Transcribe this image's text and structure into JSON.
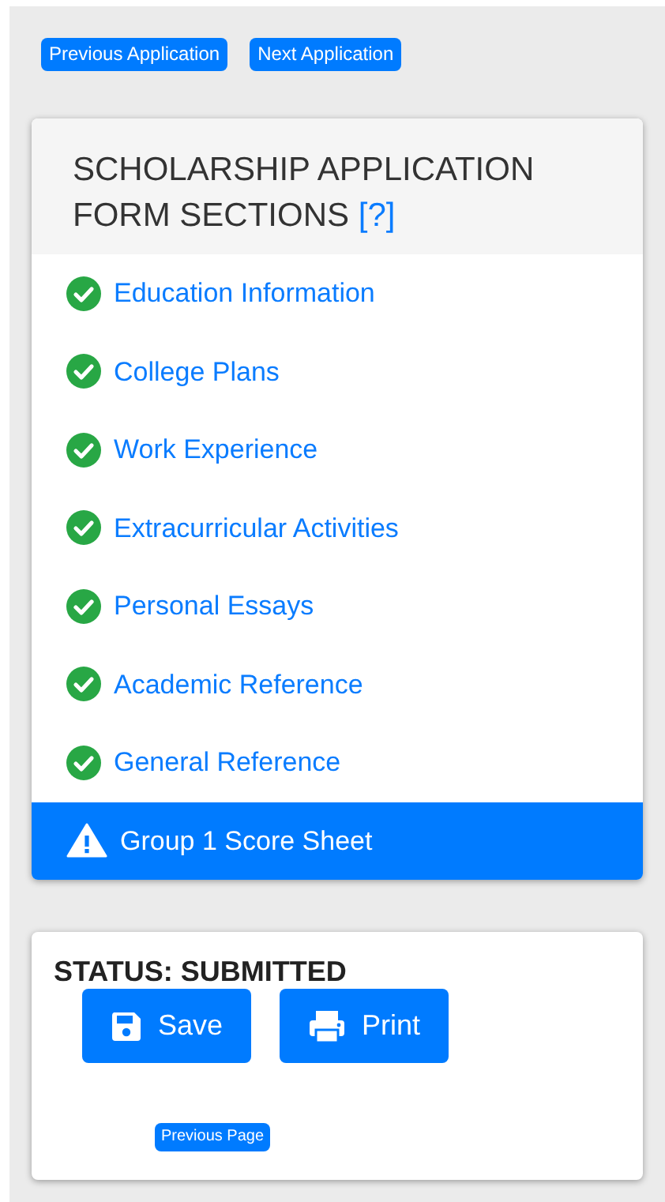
{
  "top_buttons": [
    "Previous Application",
    "Next Application"
  ],
  "sections_card": {
    "title": "SCHOLARSHIP APPLICATION FORM SECTIONS",
    "help_link": "[?]",
    "items": [
      {
        "label": "Education Information",
        "kind": "complete",
        "selected": false
      },
      {
        "label": "College Plans",
        "kind": "complete",
        "selected": false
      },
      {
        "label": "Work Experience",
        "kind": "complete",
        "selected": false
      },
      {
        "label": "Extracurricular Activities",
        "kind": "complete",
        "selected": false
      },
      {
        "label": "Personal Essays",
        "kind": "complete",
        "selected": false
      },
      {
        "label": "Academic Reference",
        "kind": "complete",
        "selected": false
      },
      {
        "label": "General Reference",
        "kind": "complete",
        "selected": false
      },
      {
        "label": "Group 1 Score Sheet",
        "kind": "warning",
        "selected": true
      }
    ]
  },
  "status_card": {
    "status": "STATUS: SUBMITTED",
    "buttons": [
      {
        "label": "Save",
        "kind": "save"
      },
      {
        "label": "Print",
        "kind": "print"
      }
    ],
    "previous_page": "Previous Page"
  }
}
